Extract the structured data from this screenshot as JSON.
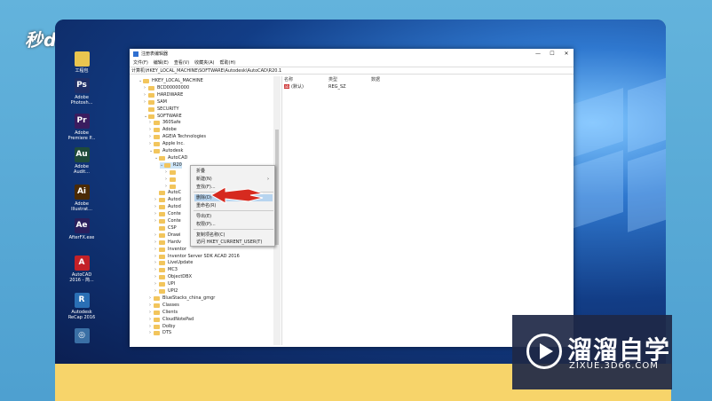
{
  "brand_logo": "秒dong视频",
  "watermark": {
    "title": "溜溜自学",
    "url": "ZIXUE.3D66.COM"
  },
  "desktop_icons": [
    {
      "label": "工程包",
      "abbr": "",
      "color": "#e9c54f"
    },
    {
      "label": "Adobe\nPhotosh...",
      "abbr": "Ps",
      "color": "#1f2f68"
    },
    {
      "label": "Adobe\nPremiere P...",
      "abbr": "Pr",
      "color": "#3a1c5f"
    },
    {
      "label": "Adobe\nAudit...",
      "abbr": "Au",
      "color": "#1f4a3a"
    },
    {
      "label": "Adobe\nIllustrat...",
      "abbr": "Ai",
      "color": "#4a2a05"
    },
    {
      "label": "AfterFX.exe",
      "abbr": "Ae",
      "color": "#2a1f5c"
    },
    {
      "label": "AutoCAD\n2016 - 简...",
      "abbr": "A",
      "color": "#c32127"
    },
    {
      "label": "Autodesk\nReCap 2016",
      "abbr": "R",
      "color": "#2a6fb5"
    },
    {
      "label": "",
      "abbr": "◎",
      "color": "#3a6fa5"
    }
  ],
  "window": {
    "title": "注册表编辑器",
    "controls": [
      "—",
      "☐",
      "✕"
    ],
    "menu": [
      "文件(F)",
      "编辑(E)",
      "查看(V)",
      "收藏夹(A)",
      "帮助(H)"
    ],
    "address": "计算机\\HKEY_LOCAL_MACHINE\\SOFTWARE\\Autodesk\\AutoCAD\\R20.1",
    "tree": [
      {
        "label": "HKEY_LOCAL_MACHINE",
        "ex": "⌄"
      },
      {
        "label": "BCD00000000",
        "ex": "›"
      },
      {
        "label": "HARDWARE",
        "ex": "›"
      },
      {
        "label": "SAM",
        "ex": "›"
      },
      {
        "label": "SECURITY",
        "ex": ""
      },
      {
        "label": "SOFTWARE",
        "ex": "⌄"
      },
      {
        "label": "360Safe",
        "ex": "›"
      },
      {
        "label": "Adobe",
        "ex": "›"
      },
      {
        "label": "AGEIA Technologies",
        "ex": "›"
      },
      {
        "label": "Apple Inc.",
        "ex": "›"
      },
      {
        "label": "Autodesk",
        "ex": "⌄"
      },
      {
        "label": "AutoCAD",
        "ex": "⌄"
      },
      {
        "label": "R20",
        "ex": "⌄"
      },
      {
        "label": "",
        "ex": "›"
      },
      {
        "label": "",
        "ex": "›"
      },
      {
        "label": "",
        "ex": "›"
      },
      {
        "label": "AutoC",
        "ex": ""
      },
      {
        "label": "Autod",
        "ex": "›"
      },
      {
        "label": "Autod",
        "ex": "›"
      },
      {
        "label": "Conte",
        "ex": "›"
      },
      {
        "label": "Conte",
        "ex": "›"
      },
      {
        "label": "CSP",
        "ex": ""
      },
      {
        "label": "Drawi",
        "ex": "›"
      },
      {
        "label": "Hardv",
        "ex": "›"
      },
      {
        "label": "Inventor",
        "ex": "›"
      },
      {
        "label": "Inventor Server SDK ACAD 2016",
        "ex": "›"
      },
      {
        "label": "LiveUpdate",
        "ex": "›"
      },
      {
        "label": "MC3",
        "ex": "›"
      },
      {
        "label": "ObjectDBX",
        "ex": "›"
      },
      {
        "label": "UPI",
        "ex": "›"
      },
      {
        "label": "UPI2",
        "ex": "›"
      },
      {
        "label": "BlueStacks_china_gmgr",
        "ex": "›"
      },
      {
        "label": "Classes",
        "ex": "›"
      },
      {
        "label": "Clients",
        "ex": "›"
      },
      {
        "label": "CloudNotePad",
        "ex": "›"
      },
      {
        "label": "Dolby",
        "ex": "›"
      },
      {
        "label": "DTS",
        "ex": "›"
      }
    ],
    "columns": [
      "名称",
      "类型",
      "数据"
    ],
    "values": [
      {
        "name": "(默认)",
        "type": "REG_SZ",
        "data": ""
      }
    ],
    "context_menu": [
      {
        "label": "折叠",
        "highlight": false
      },
      {
        "label": "新建(N)",
        "highlight": false,
        "arrow": "›"
      },
      {
        "label": "查找(F)...",
        "highlight": false
      },
      {
        "label": "删除(D)",
        "highlight": true
      },
      {
        "label": "重命名(R)",
        "highlight": false
      },
      {
        "label": "导出(E)",
        "highlight": false
      },
      {
        "label": "权限(P)...",
        "highlight": false
      },
      {
        "label": "复制项名称(C)",
        "highlight": false
      },
      {
        "label": "访问 HKEY_CURRENT_USER(T)",
        "highlight": false
      }
    ]
  }
}
